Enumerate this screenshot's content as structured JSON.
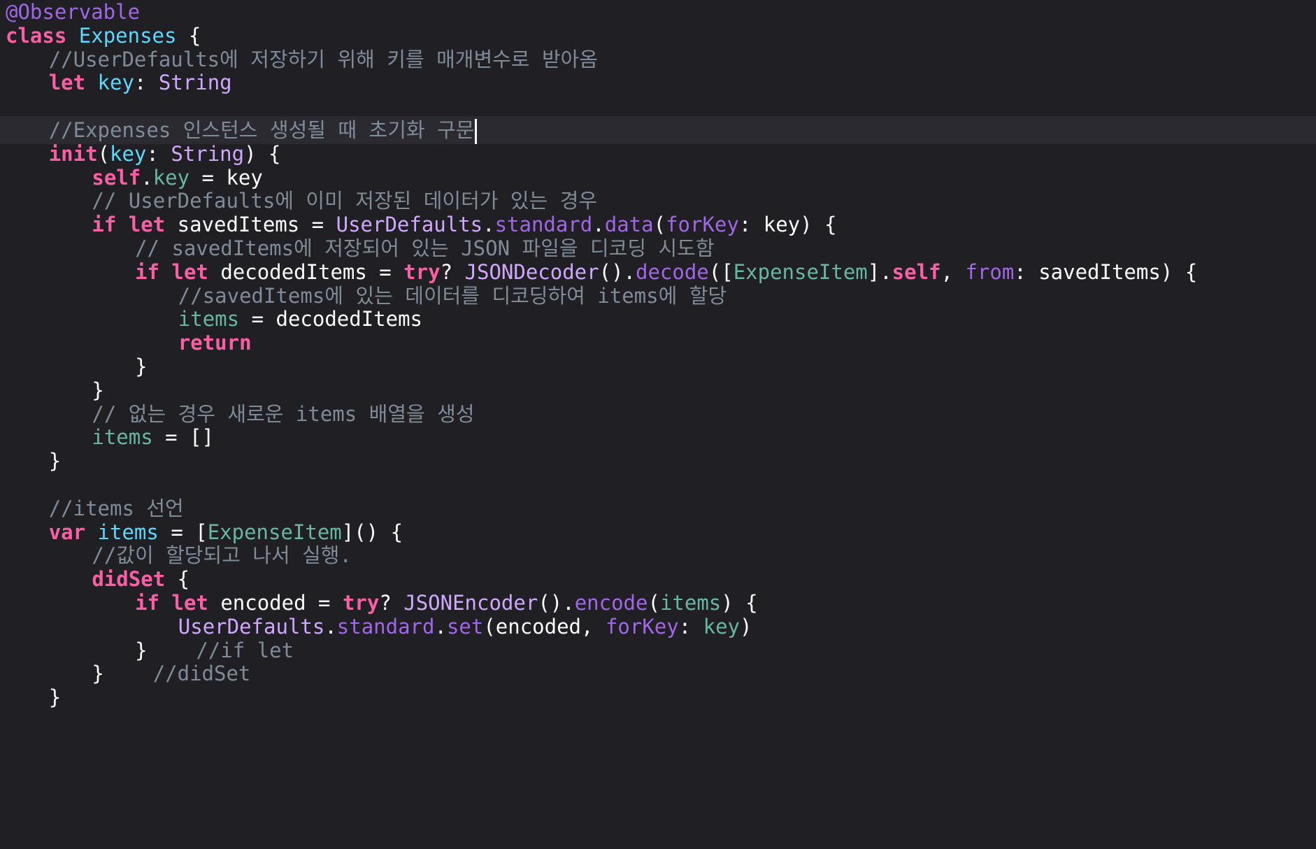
{
  "editor": {
    "colors": {
      "background": "#1f1f24",
      "current_line": "#2a2a30",
      "keyword": "#fc5fa3",
      "attribute": "#fd8f3f",
      "type_decl": "#5dd8ff",
      "type_ref": "#d0a8ff",
      "property": "#67b7a4",
      "api": "#a167e6",
      "comment": "#7f8c98",
      "plain": "#ffffff"
    },
    "lines": [
      {
        "indent": 0,
        "tokens": [
          {
            "t": "@Observable",
            "c": "api"
          }
        ]
      },
      {
        "indent": 0,
        "tokens": [
          {
            "t": "class",
            "c": "keyword"
          },
          {
            "t": " ",
            "c": "plain"
          },
          {
            "t": "Expenses",
            "c": "type_decl"
          },
          {
            "t": " {",
            "c": "plain"
          }
        ]
      },
      {
        "indent": 1,
        "tokens": [
          {
            "t": "//UserDefaults에 저장하기 위해 키를 매개변수로 받아옴",
            "c": "comment"
          }
        ]
      },
      {
        "indent": 1,
        "tokens": [
          {
            "t": "let",
            "c": "keyword"
          },
          {
            "t": " ",
            "c": "plain"
          },
          {
            "t": "key",
            "c": "type_decl"
          },
          {
            "t": ": ",
            "c": "plain"
          },
          {
            "t": "String",
            "c": "type_ref"
          }
        ]
      },
      {
        "indent": 0,
        "tokens": []
      },
      {
        "indent": 1,
        "current": true,
        "caret": true,
        "tokens": [
          {
            "t": "//Expenses 인스턴스 생성될 때 초기화 구문",
            "c": "comment"
          }
        ]
      },
      {
        "indent": 1,
        "tokens": [
          {
            "t": "init",
            "c": "keyword"
          },
          {
            "t": "(",
            "c": "plain"
          },
          {
            "t": "key",
            "c": "type_decl"
          },
          {
            "t": ": ",
            "c": "plain"
          },
          {
            "t": "String",
            "c": "type_ref"
          },
          {
            "t": ") {",
            "c": "plain"
          }
        ]
      },
      {
        "indent": 2,
        "tokens": [
          {
            "t": "self",
            "c": "keyword"
          },
          {
            "t": ".",
            "c": "plain"
          },
          {
            "t": "key",
            "c": "property"
          },
          {
            "t": " = key",
            "c": "plain"
          }
        ]
      },
      {
        "indent": 2,
        "tokens": [
          {
            "t": "// UserDefaults에 이미 저장된 데이터가 있는 경우",
            "c": "comment"
          }
        ]
      },
      {
        "indent": 2,
        "tokens": [
          {
            "t": "if",
            "c": "keyword"
          },
          {
            "t": " ",
            "c": "plain"
          },
          {
            "t": "let",
            "c": "keyword"
          },
          {
            "t": " savedItems = ",
            "c": "plain"
          },
          {
            "t": "UserDefaults",
            "c": "type_ref"
          },
          {
            "t": ".",
            "c": "plain"
          },
          {
            "t": "standard",
            "c": "api"
          },
          {
            "t": ".",
            "c": "plain"
          },
          {
            "t": "data",
            "c": "api"
          },
          {
            "t": "(",
            "c": "plain"
          },
          {
            "t": "forKey",
            "c": "api"
          },
          {
            "t": ": key) {",
            "c": "plain"
          }
        ]
      },
      {
        "indent": 3,
        "tokens": [
          {
            "t": "// savedItems에 저장되어 있는 JSON 파일을 디코딩 시도함",
            "c": "comment"
          }
        ]
      },
      {
        "indent": 3,
        "tokens": [
          {
            "t": "if",
            "c": "keyword"
          },
          {
            "t": " ",
            "c": "plain"
          },
          {
            "t": "let",
            "c": "keyword"
          },
          {
            "t": " decodedItems = ",
            "c": "plain"
          },
          {
            "t": "try",
            "c": "keyword"
          },
          {
            "t": "? ",
            "c": "plain"
          },
          {
            "t": "JSONDecoder",
            "c": "type_ref"
          },
          {
            "t": "().",
            "c": "plain"
          },
          {
            "t": "decode",
            "c": "api"
          },
          {
            "t": "([",
            "c": "plain"
          },
          {
            "t": "ExpenseItem",
            "c": "property"
          },
          {
            "t": "].",
            "c": "plain"
          },
          {
            "t": "self",
            "c": "keyword"
          },
          {
            "t": ", ",
            "c": "plain"
          },
          {
            "t": "from",
            "c": "api"
          },
          {
            "t": ": savedItems) {",
            "c": "plain"
          }
        ]
      },
      {
        "indent": 4,
        "tokens": [
          {
            "t": "//savedItems에 있는 데이터를 디코딩하여 items에 할당",
            "c": "comment"
          }
        ]
      },
      {
        "indent": 4,
        "tokens": [
          {
            "t": "items",
            "c": "property"
          },
          {
            "t": " = decodedItems",
            "c": "plain"
          }
        ]
      },
      {
        "indent": 4,
        "tokens": [
          {
            "t": "return",
            "c": "keyword"
          }
        ]
      },
      {
        "indent": 3,
        "tokens": [
          {
            "t": "}",
            "c": "plain"
          }
        ]
      },
      {
        "indent": 2,
        "tokens": [
          {
            "t": "}",
            "c": "plain"
          }
        ]
      },
      {
        "indent": 2,
        "tokens": [
          {
            "t": "// 없는 경우 새로운 items 배열을 생성",
            "c": "comment"
          }
        ]
      },
      {
        "indent": 2,
        "tokens": [
          {
            "t": "items",
            "c": "property"
          },
          {
            "t": " = []",
            "c": "plain"
          }
        ]
      },
      {
        "indent": 1,
        "tokens": [
          {
            "t": "}",
            "c": "plain"
          }
        ]
      },
      {
        "indent": 0,
        "tokens": []
      },
      {
        "indent": 1,
        "tokens": [
          {
            "t": "//items 선언",
            "c": "comment"
          }
        ]
      },
      {
        "indent": 1,
        "tokens": [
          {
            "t": "var",
            "c": "keyword"
          },
          {
            "t": " ",
            "c": "plain"
          },
          {
            "t": "items",
            "c": "type_decl"
          },
          {
            "t": " = [",
            "c": "plain"
          },
          {
            "t": "ExpenseItem",
            "c": "property"
          },
          {
            "t": "]() {",
            "c": "plain"
          }
        ]
      },
      {
        "indent": 2,
        "tokens": [
          {
            "t": "//값이 할당되고 나서 실행.",
            "c": "comment"
          }
        ]
      },
      {
        "indent": 2,
        "tokens": [
          {
            "t": "didSet",
            "c": "keyword"
          },
          {
            "t": " {",
            "c": "plain"
          }
        ]
      },
      {
        "indent": 3,
        "tokens": [
          {
            "t": "if",
            "c": "keyword"
          },
          {
            "t": " ",
            "c": "plain"
          },
          {
            "t": "let",
            "c": "keyword"
          },
          {
            "t": " encoded = ",
            "c": "plain"
          },
          {
            "t": "try",
            "c": "keyword"
          },
          {
            "t": "? ",
            "c": "plain"
          },
          {
            "t": "JSONEncoder",
            "c": "type_ref"
          },
          {
            "t": "().",
            "c": "plain"
          },
          {
            "t": "encode",
            "c": "api"
          },
          {
            "t": "(",
            "c": "plain"
          },
          {
            "t": "items",
            "c": "property"
          },
          {
            "t": ") {",
            "c": "plain"
          }
        ]
      },
      {
        "indent": 4,
        "tokens": [
          {
            "t": "UserDefaults",
            "c": "type_ref"
          },
          {
            "t": ".",
            "c": "plain"
          },
          {
            "t": "standard",
            "c": "api"
          },
          {
            "t": ".",
            "c": "plain"
          },
          {
            "t": "set",
            "c": "api"
          },
          {
            "t": "(encoded, ",
            "c": "plain"
          },
          {
            "t": "forKey",
            "c": "api"
          },
          {
            "t": ": ",
            "c": "plain"
          },
          {
            "t": "key",
            "c": "property"
          },
          {
            "t": ")",
            "c": "plain"
          }
        ]
      },
      {
        "indent": 3,
        "tokens": [
          {
            "t": "}    ",
            "c": "plain"
          },
          {
            "t": "//if let",
            "c": "comment"
          }
        ]
      },
      {
        "indent": 2,
        "tokens": [
          {
            "t": "}    ",
            "c": "plain"
          },
          {
            "t": "//didSet",
            "c": "comment"
          }
        ]
      },
      {
        "indent": 1,
        "tokens": [
          {
            "t": "}",
            "c": "plain"
          }
        ]
      }
    ]
  }
}
